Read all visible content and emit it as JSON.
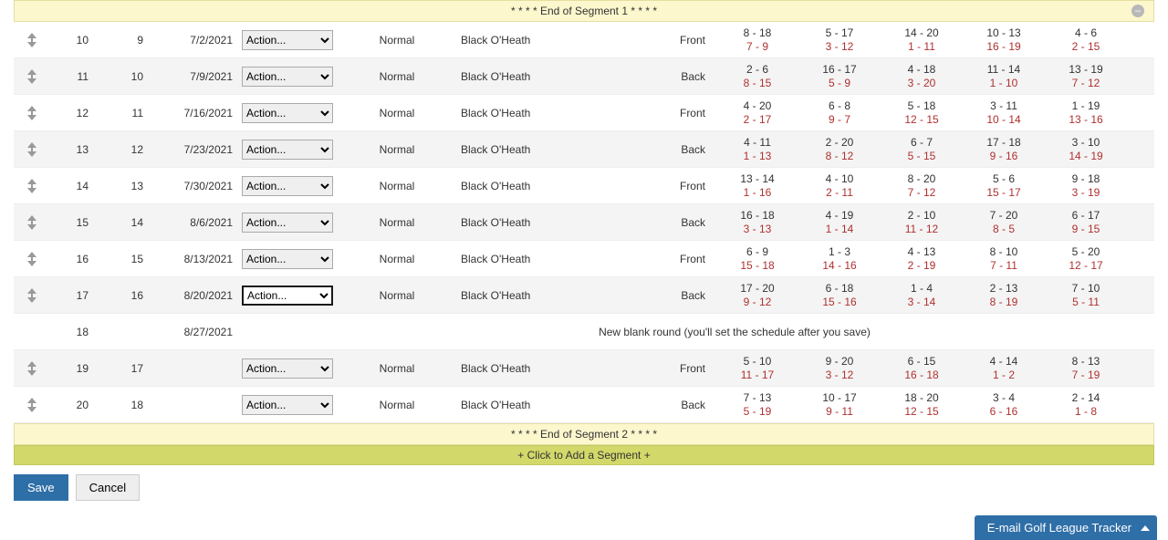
{
  "segments": {
    "end1": "* * * * End of Segment 1 * * * *",
    "end2": "* * * * End of Segment 2 * * * *",
    "add": "+ Click to Add a Segment +"
  },
  "action_label": "Action...",
  "blank_round_msg": "New blank round (you'll set the schedule after you save)",
  "buttons": {
    "save": "Save",
    "cancel": "Cancel"
  },
  "email_tracker": "E-mail Golf League Tracker",
  "rows": [
    {
      "id": "10",
      "seq": "9",
      "date": "7/2/2021",
      "type": "Normal",
      "course": "Black O'Heath",
      "side": "Front",
      "p": [
        [
          "8 - 18",
          "7 - 9"
        ],
        [
          "5 - 17",
          "3 - 12"
        ],
        [
          "14 - 20",
          "1 - 11"
        ],
        [
          "10 - 13",
          "16 - 19"
        ],
        [
          "4 - 6",
          "2 - 15"
        ]
      ]
    },
    {
      "id": "11",
      "seq": "10",
      "date": "7/9/2021",
      "type": "Normal",
      "course": "Black O'Heath",
      "side": "Back",
      "p": [
        [
          "2 - 6",
          "8 - 15"
        ],
        [
          "16 - 17",
          "5 - 9"
        ],
        [
          "4 - 18",
          "3 - 20"
        ],
        [
          "11 - 14",
          "1 - 10"
        ],
        [
          "13 - 19",
          "7 - 12"
        ]
      ]
    },
    {
      "id": "12",
      "seq": "11",
      "date": "7/16/2021",
      "type": "Normal",
      "course": "Black O'Heath",
      "side": "Front",
      "p": [
        [
          "4 - 20",
          "2 - 17"
        ],
        [
          "6 - 8",
          "9 - 7"
        ],
        [
          "5 - 18",
          "12 - 15"
        ],
        [
          "3 - 11",
          "10 - 14"
        ],
        [
          "1 - 19",
          "13 - 16"
        ]
      ]
    },
    {
      "id": "13",
      "seq": "12",
      "date": "7/23/2021",
      "type": "Normal",
      "course": "Black O'Heath",
      "side": "Back",
      "p": [
        [
          "4 - 11",
          "1 - 13"
        ],
        [
          "2 - 20",
          "8 - 12"
        ],
        [
          "6 - 7",
          "5 - 15"
        ],
        [
          "17 - 18",
          "9 - 16"
        ],
        [
          "3 - 10",
          "14 - 19"
        ]
      ]
    },
    {
      "id": "14",
      "seq": "13",
      "date": "7/30/2021",
      "type": "Normal",
      "course": "Black O'Heath",
      "side": "Front",
      "p": [
        [
          "13 - 14",
          "1 - 16"
        ],
        [
          "4 - 10",
          "2 - 11"
        ],
        [
          "8 - 20",
          "7 - 12"
        ],
        [
          "5 - 6",
          "15 - 17"
        ],
        [
          "9 - 18",
          "3 - 19"
        ]
      ]
    },
    {
      "id": "15",
      "seq": "14",
      "date": "8/6/2021",
      "type": "Normal",
      "course": "Black O'Heath",
      "side": "Back",
      "p": [
        [
          "16 - 18",
          "3 - 13"
        ],
        [
          "4 - 19",
          "1 - 14"
        ],
        [
          "2 - 10",
          "11 - 12"
        ],
        [
          "7 - 20",
          "8 - 5"
        ],
        [
          "6 - 17",
          "9 - 15"
        ]
      ]
    },
    {
      "id": "16",
      "seq": "15",
      "date": "8/13/2021",
      "type": "Normal",
      "course": "Black O'Heath",
      "side": "Front",
      "p": [
        [
          "6 - 9",
          "15 - 18"
        ],
        [
          "1 - 3",
          "14 - 16"
        ],
        [
          "4 - 13",
          "2 - 19"
        ],
        [
          "8 - 10",
          "7 - 11"
        ],
        [
          "5 - 20",
          "12 - 17"
        ]
      ]
    },
    {
      "id": "17",
      "seq": "16",
      "date": "8/20/2021",
      "type": "Normal",
      "course": "Black O'Heath",
      "side": "Back",
      "focused": true,
      "p": [
        [
          "17 - 20",
          "9 - 12"
        ],
        [
          "6 - 18",
          "15 - 16"
        ],
        [
          "1 - 4",
          "3 - 14"
        ],
        [
          "2 - 13",
          "8 - 19"
        ],
        [
          "7 - 10",
          "5 - 11"
        ]
      ]
    },
    {
      "id": "18",
      "seq": "",
      "date": "8/27/2021",
      "blank": true
    },
    {
      "id": "19",
      "seq": "17",
      "date": "",
      "type": "Normal",
      "course": "Black O'Heath",
      "side": "Front",
      "p": [
        [
          "5 - 10",
          "11 - 17"
        ],
        [
          "9 - 20",
          "3 - 12"
        ],
        [
          "6 - 15",
          "16 - 18"
        ],
        [
          "4 - 14",
          "1 - 2"
        ],
        [
          "8 - 13",
          "7 - 19"
        ]
      ]
    },
    {
      "id": "20",
      "seq": "18",
      "date": "",
      "type": "Normal",
      "course": "Black O'Heath",
      "side": "Back",
      "p": [
        [
          "7 - 13",
          "5 - 19"
        ],
        [
          "10 - 17",
          "9 - 11"
        ],
        [
          "18 - 20",
          "12 - 15"
        ],
        [
          "3 - 4",
          "6 - 16"
        ],
        [
          "2 - 14",
          "1 - 8"
        ]
      ]
    }
  ]
}
